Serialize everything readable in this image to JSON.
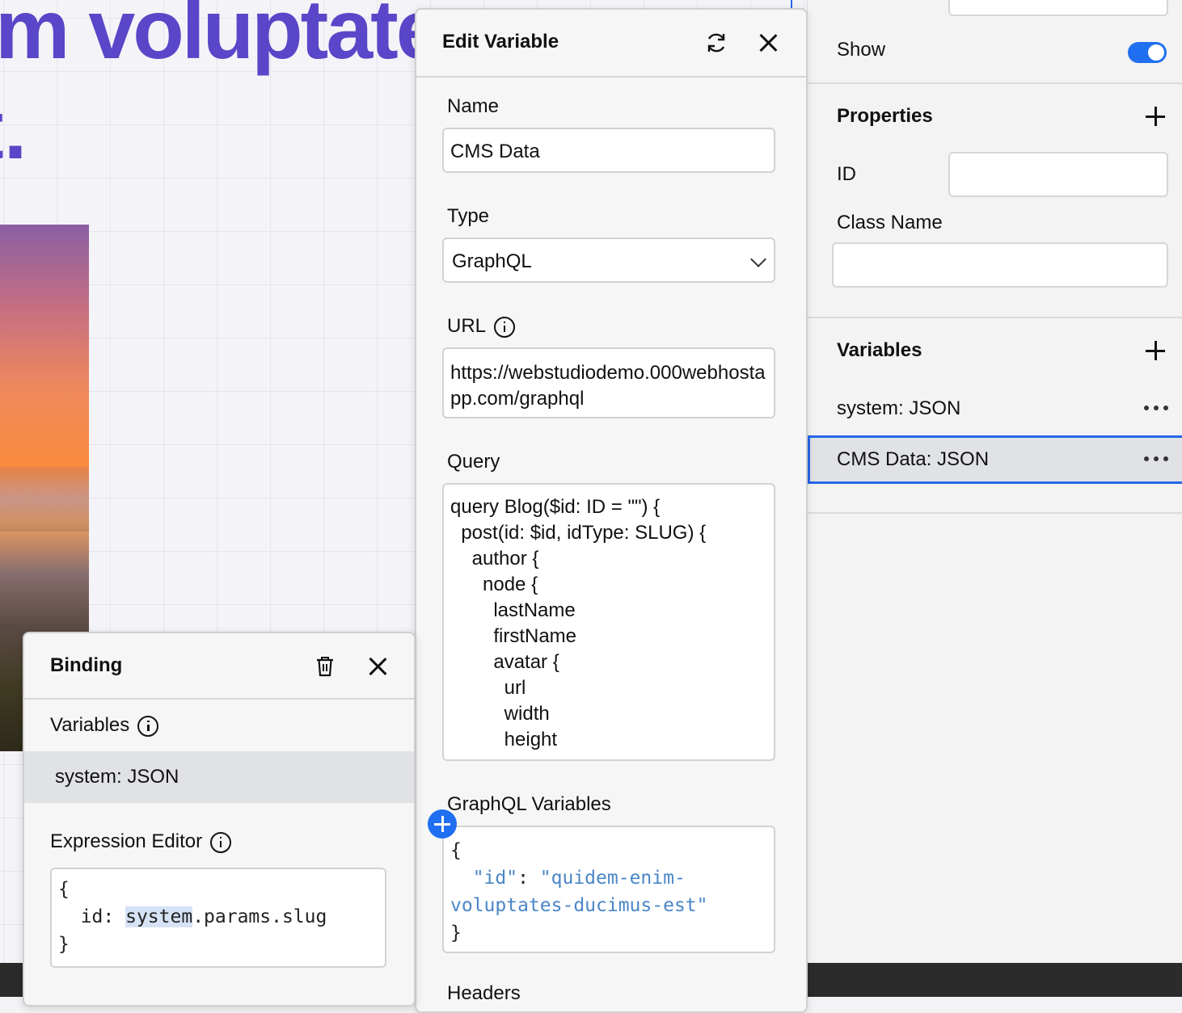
{
  "canvas": {
    "hero_line1": "m voluptate",
    "hero_line2": "t."
  },
  "right_panel": {
    "show_label": "Show",
    "show_enabled": true,
    "properties_heading": "Properties",
    "id_label": "ID",
    "id_value": "",
    "class_name_label": "Class Name",
    "class_name_value": "",
    "variables_heading": "Variables",
    "variables": [
      {
        "label": "system: JSON",
        "selected": false
      },
      {
        "label": "CMS Data: JSON",
        "selected": true
      }
    ]
  },
  "edit_variable": {
    "title": "Edit Variable",
    "name_label": "Name",
    "name_value": "CMS Data",
    "type_label": "Type",
    "type_value": "GraphQL",
    "url_label": "URL",
    "url_value": "https://webstudiodemo.000webhostapp.com/graphql",
    "query_label": "Query",
    "query_lines": [
      "query Blog($id: ID = \"\") {",
      "  post(id: $id, idType: SLUG) {",
      "    author {",
      "      node {",
      "        lastName",
      "        firstName",
      "        avatar {",
      "          url",
      "          width",
      "          height"
    ],
    "graphql_variables_label": "GraphQL Variables",
    "graphql_variables": {
      "open": "{",
      "key": "\"id\"",
      "colon": ": ",
      "value_part1": "\"quidem-enim-",
      "value_part2": "voluptates-ducimus-est\"",
      "close": "}"
    },
    "headers_label": "Headers"
  },
  "binding": {
    "title": "Binding",
    "variables_label": "Variables",
    "variable_item": "system: JSON",
    "expression_editor_label": "Expression Editor",
    "expression": {
      "line1": "{",
      "line2_prefix": "  id: ",
      "line2_highlight": "system",
      "line2_suffix": ".params.slug",
      "line3": "}"
    }
  },
  "colors": {
    "accent": "#1f6ff0",
    "hero_text": "#5a46c8",
    "selection_border": "#2567e8"
  }
}
